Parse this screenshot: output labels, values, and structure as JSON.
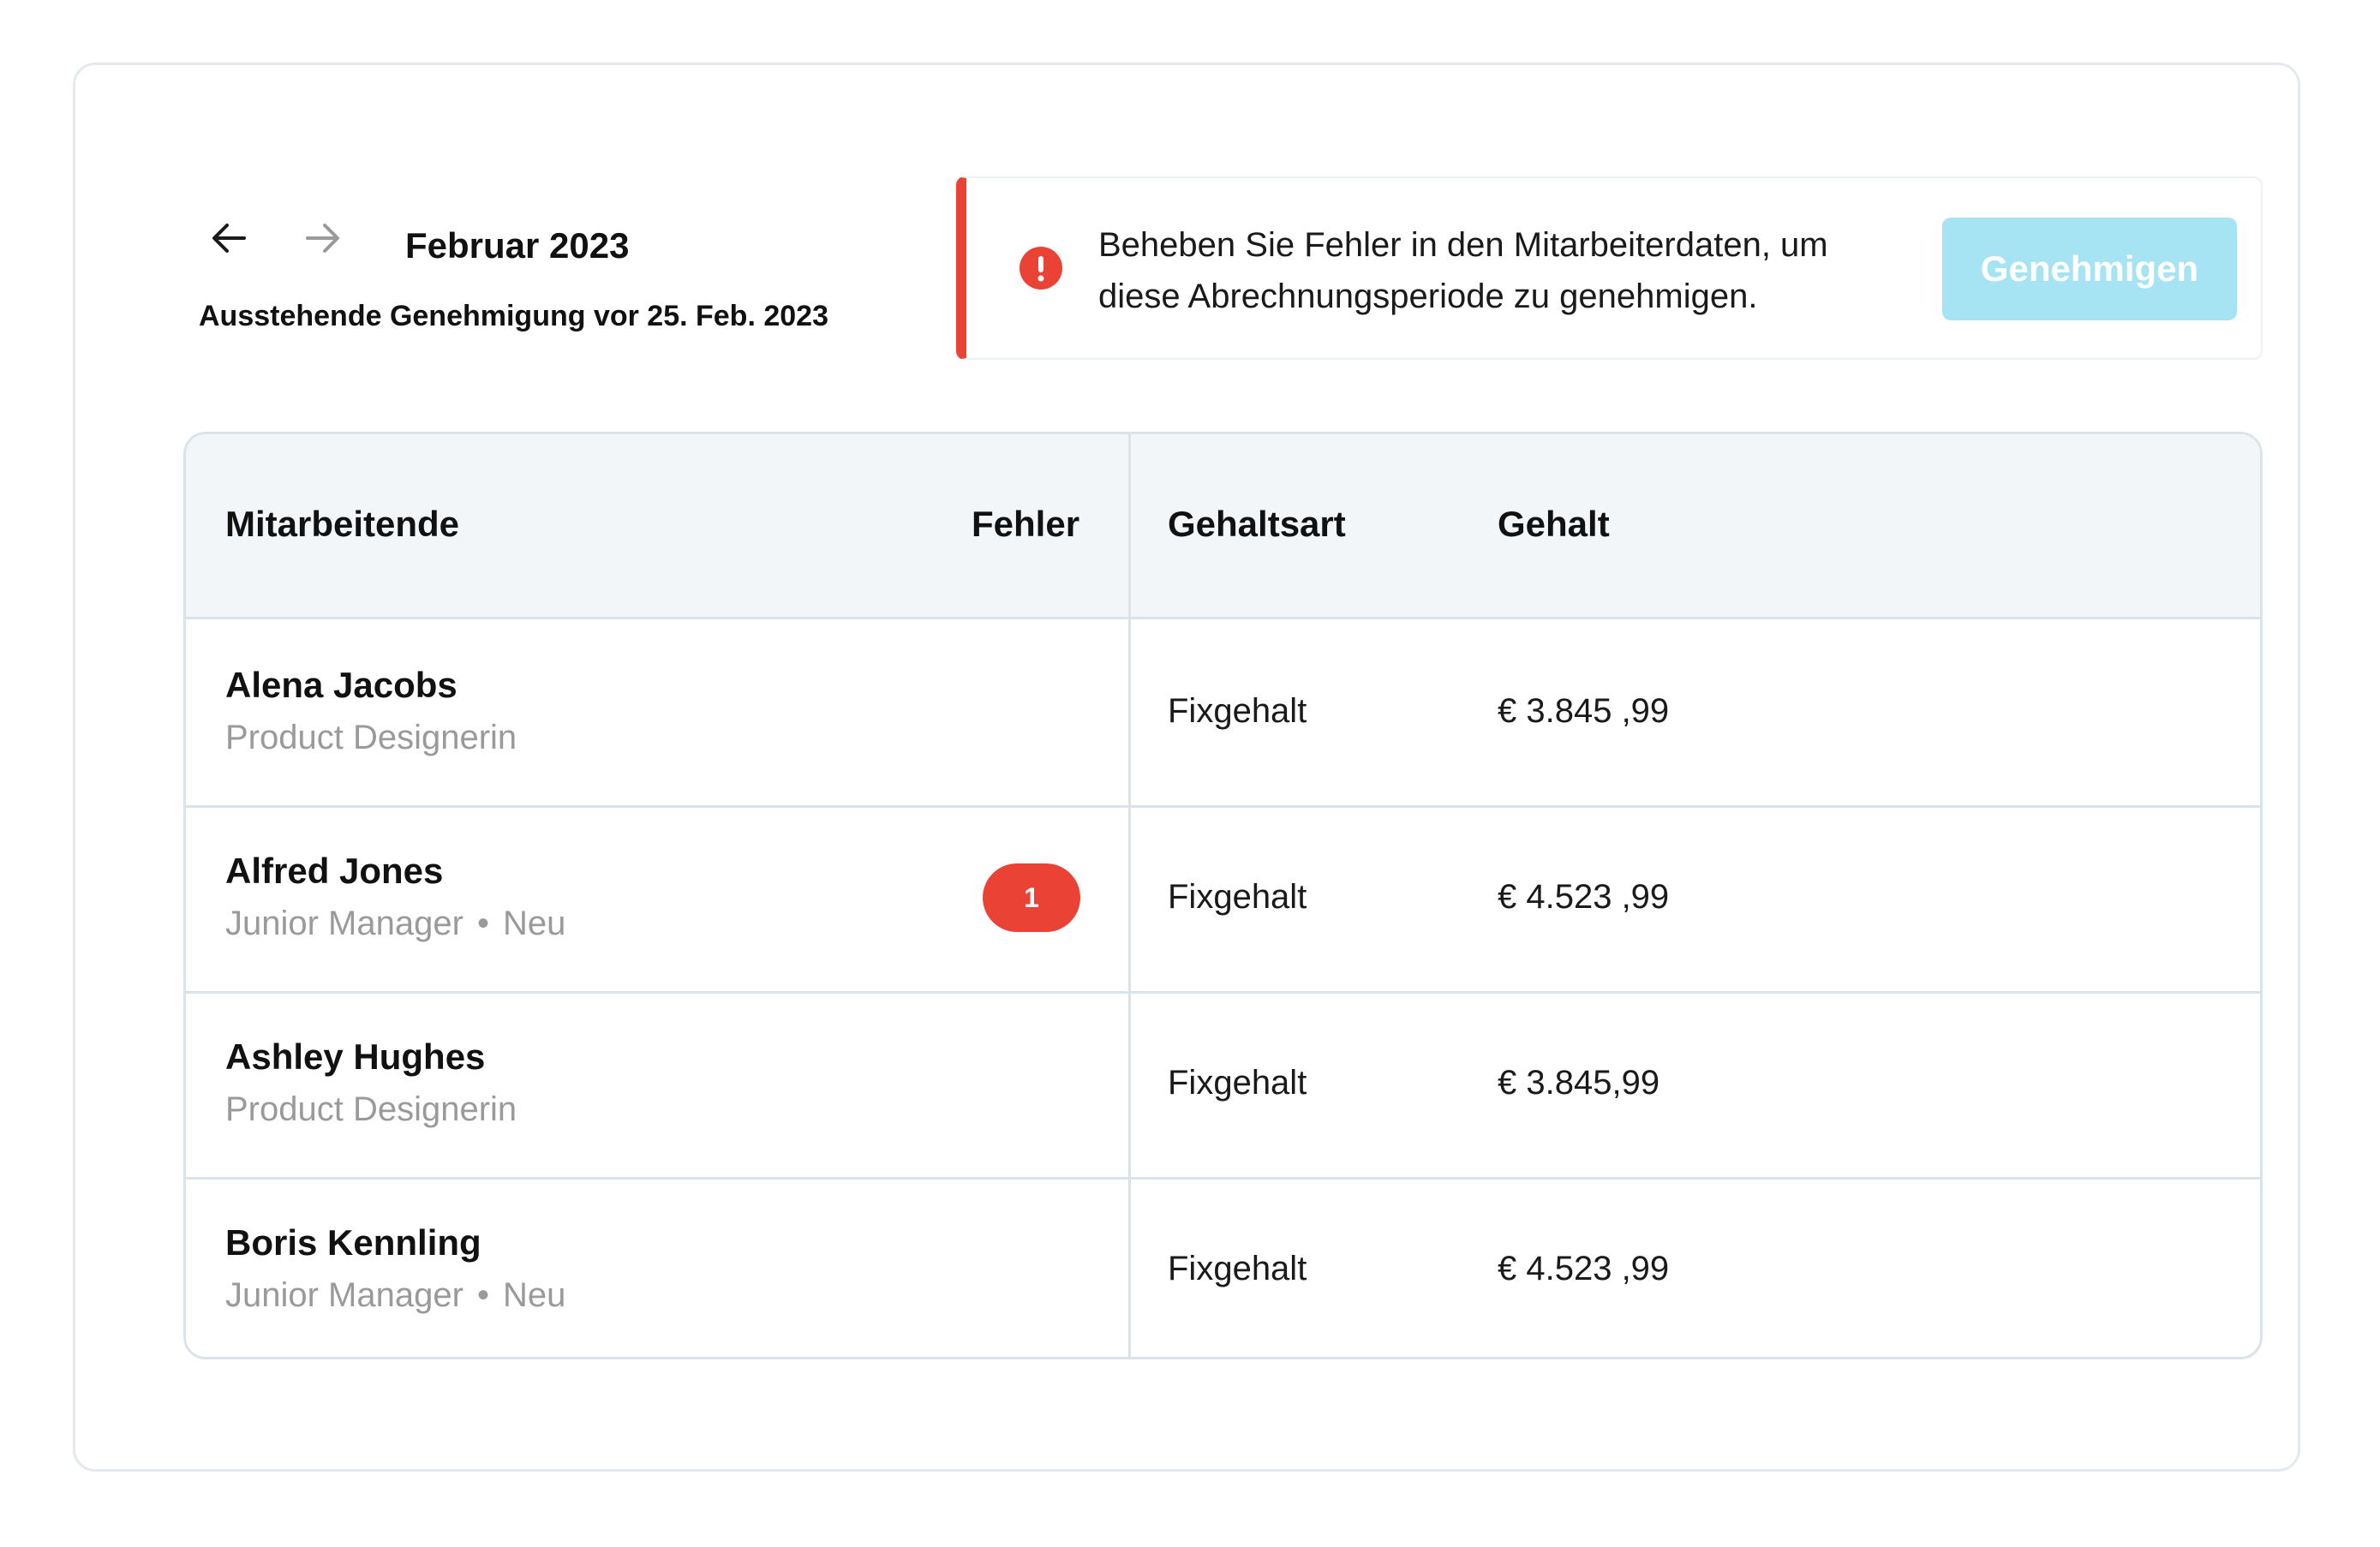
{
  "header": {
    "period": "Februar 2023",
    "subtitle": "Ausstehende Genehmigung vor 25. Feb. 2023",
    "prev_icon": "arrow-left-icon",
    "next_icon": "arrow-right-icon"
  },
  "alert": {
    "icon": "error-icon",
    "line1": "Beheben Sie Fehler in den Mitarbeiterdaten, um",
    "line2": "diese Abrechnungsperiode zu genehmigen.",
    "button_label": "Genehmigen",
    "accent_color": "#ea4335",
    "button_color": "#a6e3f3"
  },
  "table": {
    "columns": {
      "employee": "Mitarbeitende",
      "errors": "Fehler",
      "pay_type": "Gehaltsart",
      "salary": "Gehalt"
    },
    "rows": [
      {
        "name": "Alena Jacobs",
        "role": "Product Designerin",
        "tag": "",
        "errors": "",
        "pay_type": "Fixgehalt",
        "salary": "€ 3.845 ,99"
      },
      {
        "name": "Alfred Jones",
        "role": "Junior Manager",
        "tag": "Neu",
        "errors": "1",
        "pay_type": "Fixgehalt",
        "salary": "€ 4.523 ,99"
      },
      {
        "name": "Ashley Hughes",
        "role": "Product Designerin",
        "tag": "",
        "errors": "",
        "pay_type": "Fixgehalt",
        "salary": "€ 3.845,99"
      },
      {
        "name": "Boris Kennling",
        "role": "Junior Manager",
        "tag": "Neu",
        "errors": "",
        "pay_type": "Fixgehalt",
        "salary": "€ 4.523 ,99"
      }
    ]
  }
}
